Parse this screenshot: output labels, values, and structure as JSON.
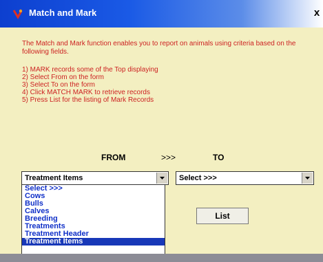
{
  "window": {
    "title": "Match and Mark",
    "close_glyph": "x"
  },
  "instructions": {
    "intro": "The Match and Mark function enables you to report on animals using criteria based on the following fields.",
    "steps": [
      "1) MARK records some of the Top displaying",
      "2) Select From on the form",
      "3) Select To on the form",
      "4) Click MATCH MARK to retrieve records",
      "5) Press List for the listing of Mark Records"
    ]
  },
  "headers": {
    "from": "FROM",
    "arrow": ">>>",
    "to": "TO"
  },
  "from_select": {
    "value": "Treatment Items",
    "options": [
      "Select >>>",
      "Cows",
      "Bulls",
      "Calves",
      "Breeding",
      "Treatments",
      "Treatment Header",
      "Treatment Items"
    ],
    "selected_index": 7
  },
  "to_select": {
    "value": "Select >>>"
  },
  "list_button": {
    "label": "List"
  },
  "colors": {
    "dialog_bg": "#f3efc1",
    "instruction_text": "#cc2222",
    "option_text": "#1030c8",
    "selection_bg": "#1838b8",
    "title_bar": "#0d3fcf"
  }
}
